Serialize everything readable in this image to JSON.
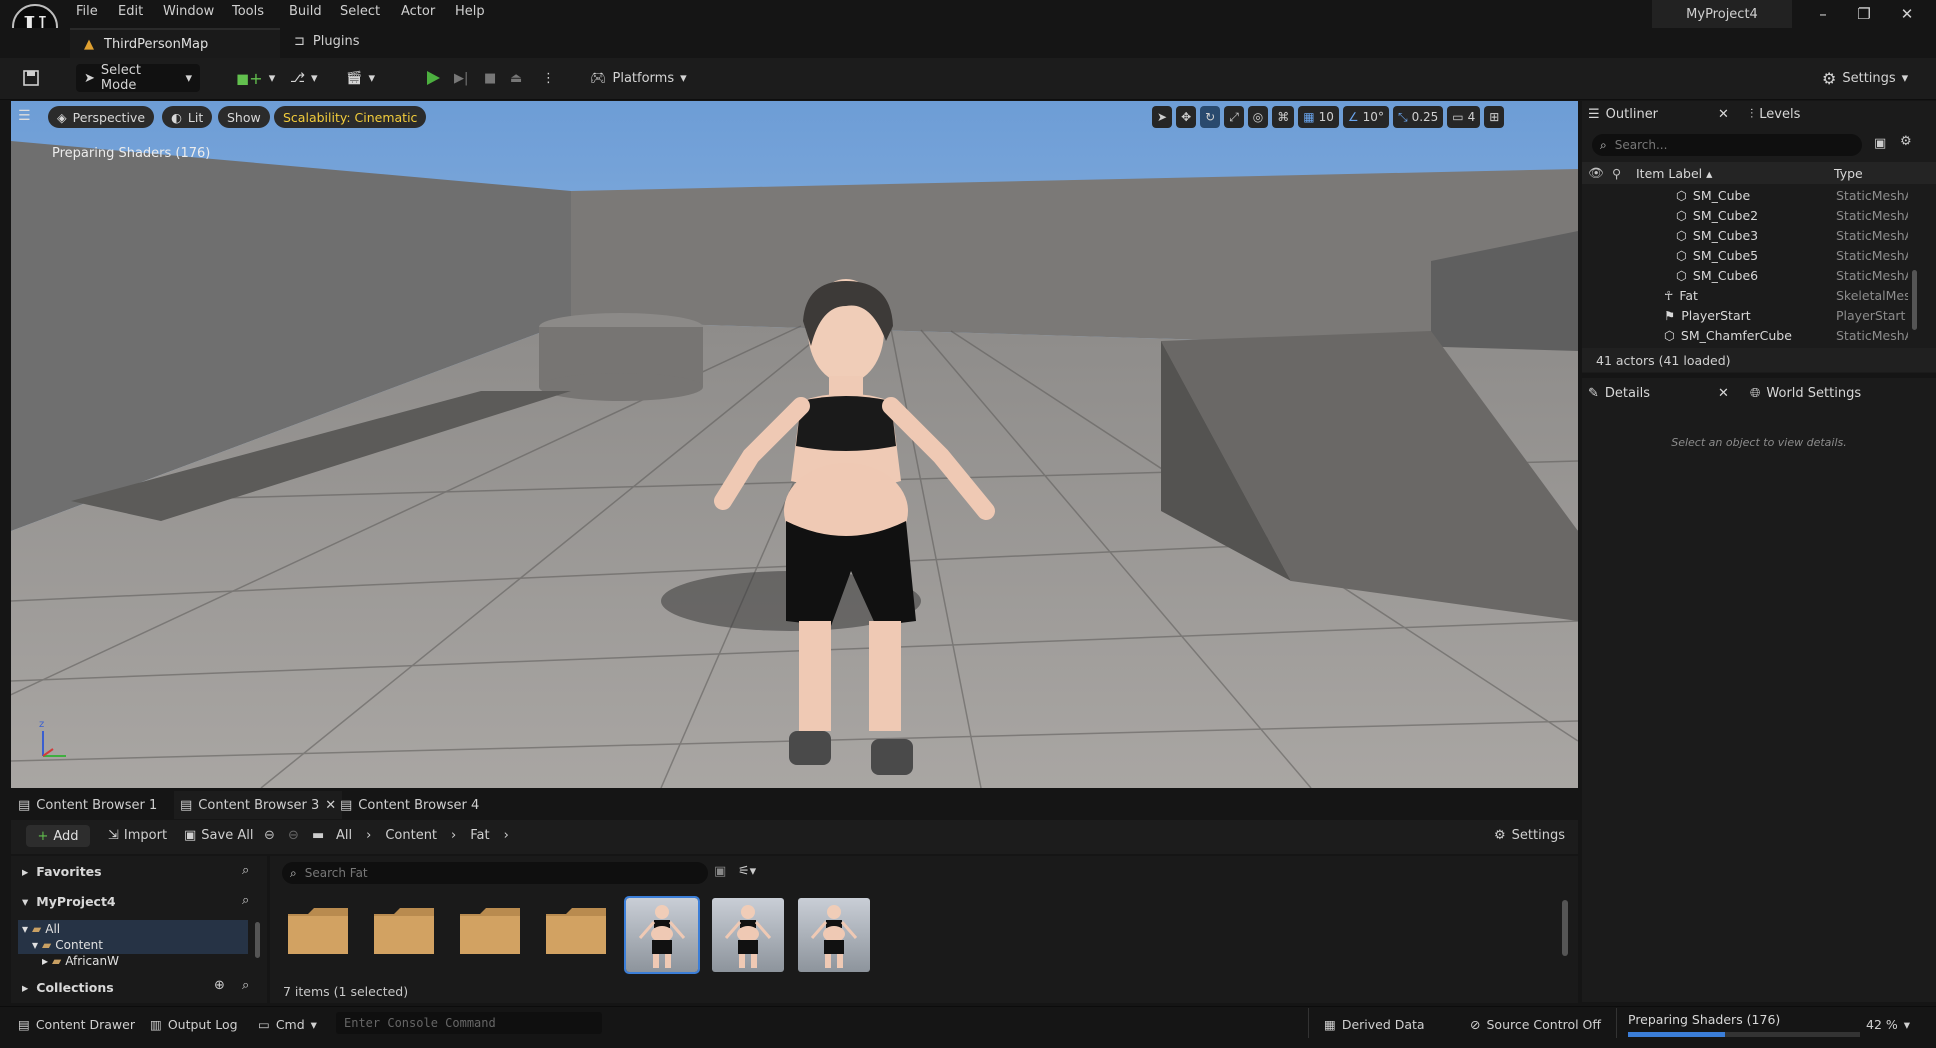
{
  "menubar": {
    "items": [
      "File",
      "Edit",
      "Window",
      "Tools",
      "Build",
      "Select",
      "Actor",
      "Help"
    ],
    "project": "MyProject4"
  },
  "tabs": {
    "map": "ThirdPersonMap",
    "plugins": "Plugins"
  },
  "toolbar": {
    "select_mode": "Select Mode",
    "platforms": "Platforms",
    "settings": "Settings"
  },
  "viewport": {
    "perspective": "Perspective",
    "lit": "Lit",
    "show": "Show",
    "scalability": "Scalability: Cinematic",
    "status": "Preparing Shaders (176)",
    "grid": "10",
    "angle": "10°",
    "scale": "0.25",
    "camera": "4"
  },
  "outliner": {
    "tab": "Outliner",
    "levels": "Levels",
    "search_placeholder": "Search...",
    "col_label": "Item Label",
    "col_type": "Type",
    "rows": [
      {
        "label": "SM_Cube",
        "type": "StaticMeshA"
      },
      {
        "label": "SM_Cube2",
        "type": "StaticMeshA"
      },
      {
        "label": "SM_Cube3",
        "type": "StaticMeshA"
      },
      {
        "label": "SM_Cube5",
        "type": "StaticMeshA"
      },
      {
        "label": "SM_Cube6",
        "type": "StaticMeshA"
      },
      {
        "label": "Fat",
        "type": "SkeletalMes"
      },
      {
        "label": "PlayerStart",
        "type": "PlayerStart"
      },
      {
        "label": "SM_ChamferCube",
        "type": "StaticMeshA"
      }
    ],
    "count": "41 actors (41 loaded)"
  },
  "details": {
    "tab": "Details",
    "world": "World Settings",
    "hint": "Select an object to view details."
  },
  "content_browser": {
    "tabs": [
      "Content Browser 1",
      "Content Browser 3",
      "Content Browser 4"
    ],
    "add": "Add",
    "import": "Import",
    "save_all": "Save All",
    "path": [
      "All",
      "Content",
      "Fat"
    ],
    "settings": "Settings",
    "favorites": "Favorites",
    "project": "MyProject4",
    "tree": [
      "All",
      "Content",
      "AfricanW"
    ],
    "collections": "Collections",
    "search_placeholder": "Search Fat",
    "items_status": "7 items (1 selected)"
  },
  "statusbar": {
    "content_drawer": "Content Drawer",
    "output_log": "Output Log",
    "cmd": "Cmd",
    "console_placeholder": "Enter Console Command",
    "derived": "Derived Data",
    "source": "Source Control Off",
    "shaders": "Preparing Shaders (176)",
    "percent": "42 %",
    "shader_progress": 0.42
  },
  "colors": {
    "accent": "#3b7ed8",
    "play": "#4caf3f",
    "scalability": "#f2cc3b"
  }
}
